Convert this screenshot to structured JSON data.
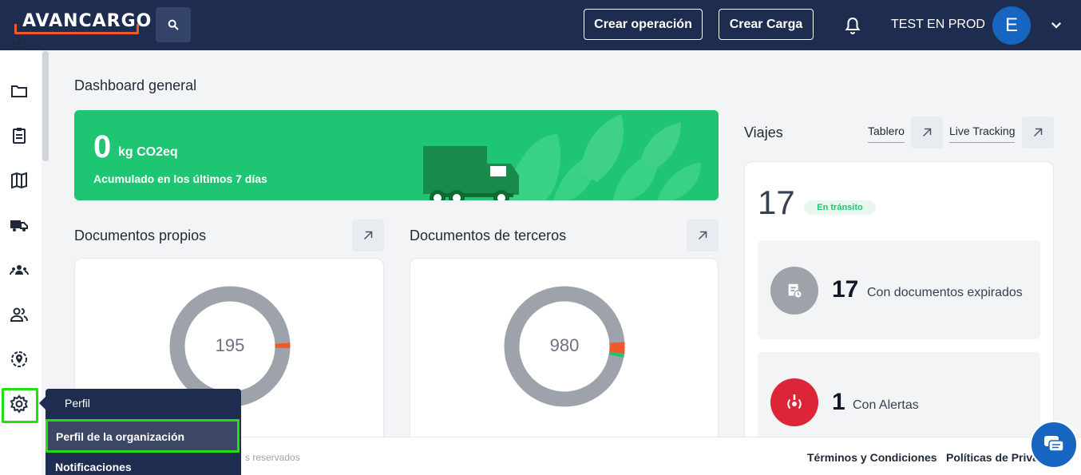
{
  "header": {
    "logo_text": "AVANCARGO",
    "create_operation_label": "Crear operación",
    "create_load_label": "Crear Carga",
    "user_name": "TEST EN PROD",
    "avatar_initial": "E",
    "colors": {
      "bar": "#1e2d4f",
      "accent": "#f05a28",
      "avatar": "#1666c1"
    }
  },
  "sidebar": {
    "icons": [
      "clipboard-check-icon",
      "folder-icon",
      "clipboard-list-icon",
      "map-icon",
      "truck-icon",
      "team-icon",
      "users-icon",
      "location-icon",
      "gear-icon"
    ],
    "active": "gear-icon"
  },
  "settings_menu": {
    "items": [
      "Perfil",
      "Perfil de la organización",
      "Notificaciones"
    ],
    "highlighted": "Perfil de la organización"
  },
  "dashboard": {
    "title": "Dashboard general",
    "co2": {
      "value": "0",
      "unit": "kg CO2eq",
      "subtitle": "Acumulado en los últimos 7 días",
      "color": "#1ec673"
    },
    "own_documents": {
      "title": "Documentos propios",
      "total": "195"
    },
    "third_party_documents": {
      "title": "Documentos de terceros",
      "total": "980"
    }
  },
  "viajes": {
    "title": "Viajes",
    "links": [
      "Tablero",
      "Live Tracking"
    ],
    "in_transit_count": "17",
    "in_transit_badge": "En tránsito",
    "expired_docs": {
      "count": "17",
      "label": "Con documentos expirados"
    },
    "alerts": {
      "count": "1",
      "label": "Con Alertas"
    }
  },
  "footer": {
    "copyright": "s reservados",
    "links": [
      "Términos y Condiciones",
      "Políticas de Priva"
    ]
  }
}
